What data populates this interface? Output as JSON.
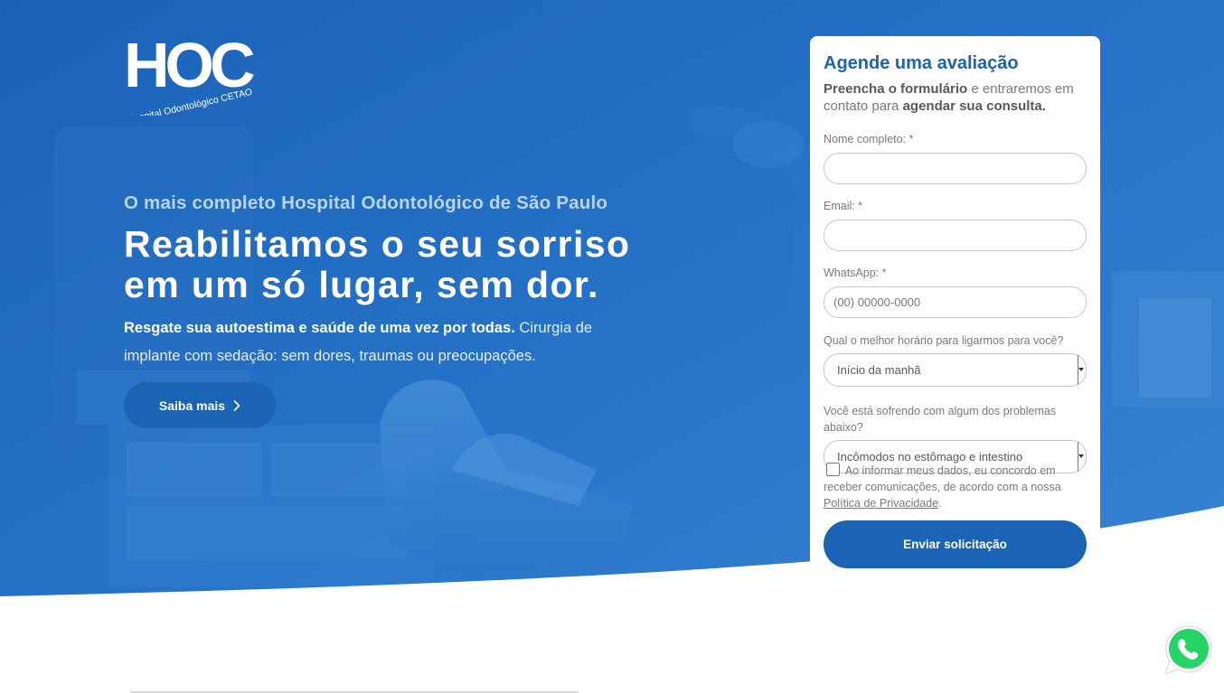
{
  "brand": {
    "logo_letters": "HOC",
    "logo_tagline": "Hospital Odontológico CETAO",
    "colors": {
      "primary": "#1b63b4",
      "hero_overlay": "#1f6bc3",
      "white": "#ffffff"
    }
  },
  "hero": {
    "kicker": "O mais completo Hospital Odontológico de São Paulo",
    "headline_line1": "Reabilitamos o seu sorriso",
    "headline_line2": "em um só lugar, sem dor.",
    "lead_strong": "Resgate sua autoestima e saúde de uma vez por todas.",
    "lead_rest": " Cirurgia de implante com sedação: sem dores, traumas ou preocupações.",
    "cta_label": "Saiba mais",
    "cta_icon": "chevron-right-icon"
  },
  "form": {
    "title": "Agende uma avaliação",
    "intro_strong1": "Preencha o formulário",
    "intro_mid": " e entraremos em contato para ",
    "intro_strong2": "agendar sua consulta.",
    "fields": {
      "name_label": "Nome completo: *",
      "name_value": "",
      "email_label": "Email: *",
      "email_value": "",
      "whatsapp_label": "WhatsApp: *",
      "whatsapp_placeholder": "(00) 00000-0000",
      "time_label": "Qual o melhor horário para ligarmos para você?",
      "time_selected": "Início da manhã",
      "problem_label": "Você está sofrendo com algum dos problemas abaixo?",
      "problem_selected": "Incômodos no estômago e intestino"
    },
    "consent_text": "Ao informar meus dados, eu concordo em receber comunicações, de acordo com a nossa ",
    "consent_link": "Política de Privacidade",
    "consent_end": ".",
    "consent_checked": false,
    "submit_label": "Enviar solicitação"
  },
  "floating": {
    "whatsapp_icon": "whatsapp-icon",
    "whatsapp_color": "#25d366"
  }
}
